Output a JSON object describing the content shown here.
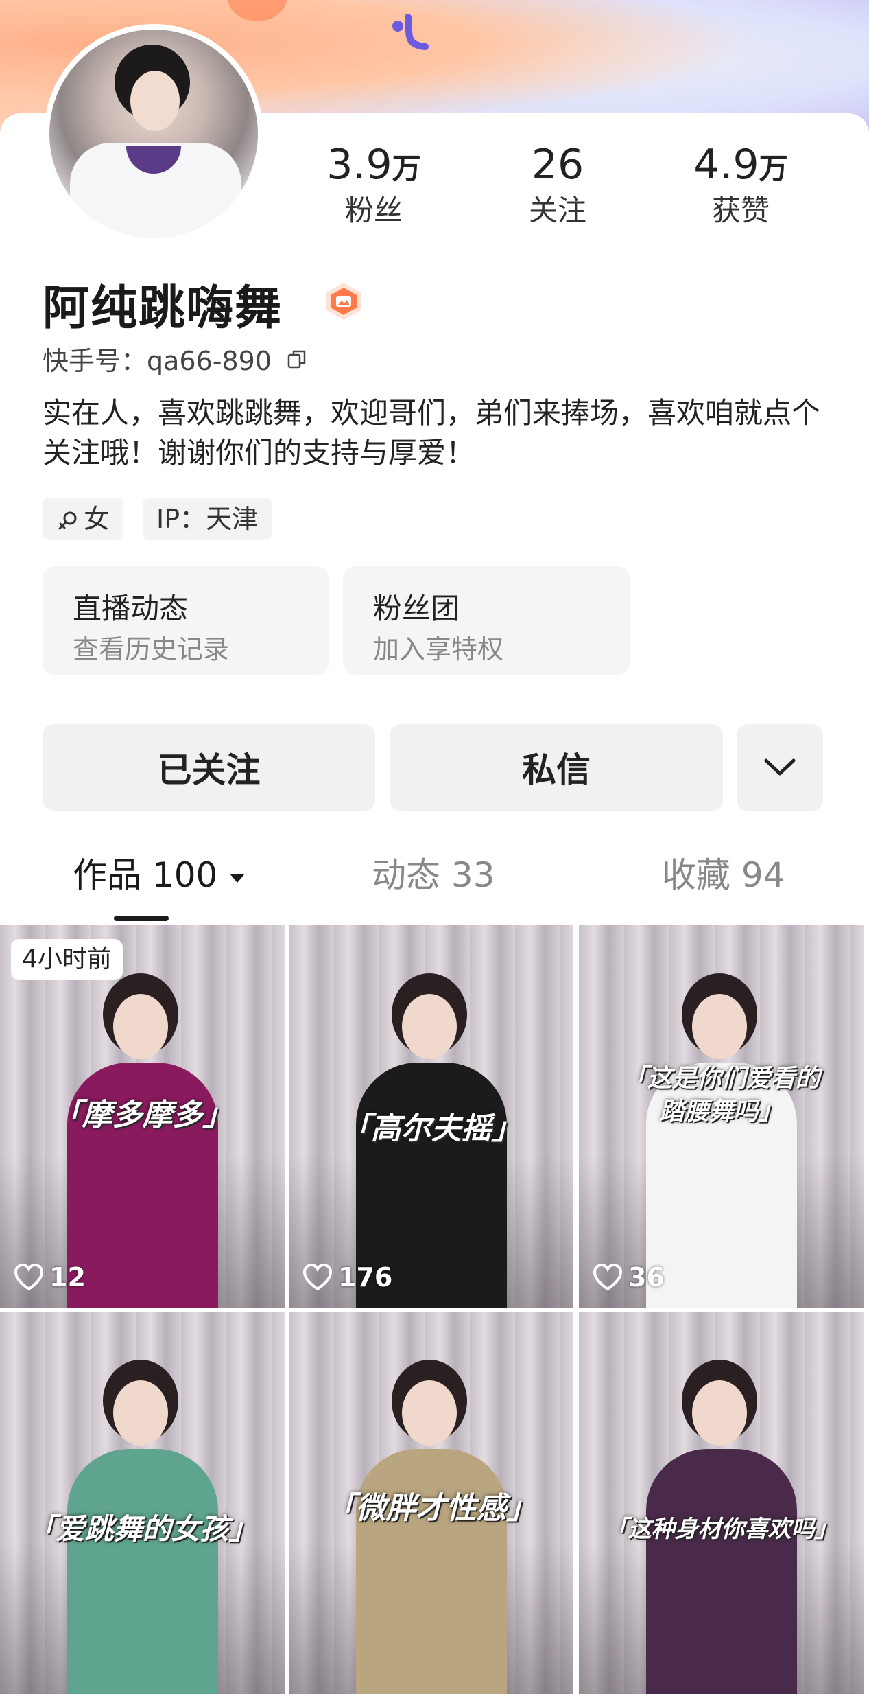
{
  "profile": {
    "name": "阿纯跳嗨舞",
    "kuaishou_id": "快手号：qa66-890",
    "bio": "实在人，喜欢跳跳舞，欢迎哥们，弟们来捧场，喜欢咱就点个关注哦！谢谢你们的支持与厚爱！",
    "tags": [
      "女",
      "IP：天津"
    ]
  },
  "stats": [
    {
      "value": "3.9",
      "unit": "万",
      "label": "粉丝"
    },
    {
      "value": "26",
      "unit": "",
      "label": "关注"
    },
    {
      "value": "4.9",
      "unit": "万",
      "label": "获赞"
    }
  ],
  "info_cards": [
    {
      "title": "直播动态",
      "subtitle": "查看历史记录"
    },
    {
      "title": "粉丝团",
      "subtitle": "加入享特权"
    }
  ],
  "actions": {
    "follow": "已关注",
    "message": "私信"
  },
  "tabs": [
    {
      "label": "作品 100",
      "active": true
    },
    {
      "label": "动态 33",
      "active": false
    },
    {
      "label": "收藏 94",
      "active": false
    }
  ],
  "videos": [
    {
      "caption": "「摩多摩多」",
      "likes": "12",
      "time": "4小时前",
      "outfit": "#8a1a5e"
    },
    {
      "caption": "「高尔夫摇」",
      "likes": "176",
      "time": "",
      "outfit": "#1b1b1b"
    },
    {
      "caption": "「这是你们爱看的\n踏腰舞吗」",
      "likes": "36",
      "time": "",
      "outfit": "#f4f4f4"
    },
    {
      "caption": "「爱跳舞的女孩」",
      "likes": "",
      "time": "",
      "outfit": "#5fa48f"
    },
    {
      "caption": "「微胖才性感」",
      "likes": "",
      "time": "",
      "outfit": "#b9a57f"
    },
    {
      "caption": "「这种身材你喜欢吗」",
      "likes": "",
      "time": "",
      "outfit": "#4a2a4a"
    }
  ],
  "colors": {
    "accent_badge": "#ff7a4a",
    "text_dark": "#1a1a1a",
    "text_muted": "#888888"
  }
}
